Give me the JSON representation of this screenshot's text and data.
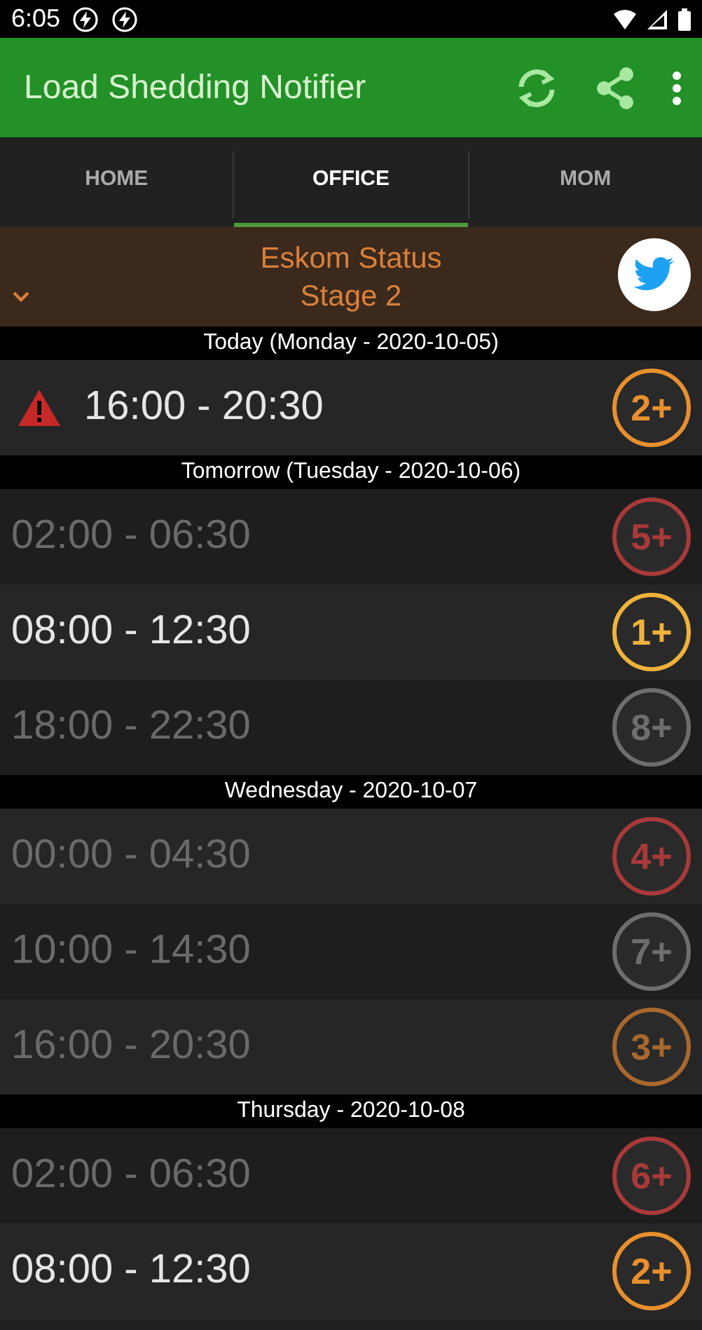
{
  "status_bar": {
    "time": "6:05"
  },
  "app_bar": {
    "title": "Load Shedding Notifier"
  },
  "tabs": [
    {
      "label": "HOME",
      "selected": false
    },
    {
      "label": "OFFICE",
      "selected": true
    },
    {
      "label": "MOM",
      "selected": false
    }
  ],
  "status_banner": {
    "title": "Eskom Status",
    "stage": "Stage 2",
    "expanded": false
  },
  "days": [
    {
      "header": "Today (Monday - 2020-10-05)",
      "slots": [
        {
          "time": "16:00 - 20:30",
          "stage": "2+",
          "color": "#e8902e",
          "faded": false,
          "alert": true
        }
      ]
    },
    {
      "header": "Tomorrow (Tuesday - 2020-10-06)",
      "slots": [
        {
          "time": "02:00 - 06:30",
          "stage": "5+",
          "color": "#a83a3a",
          "faded": true,
          "alert": false
        },
        {
          "time": "08:00 - 12:30",
          "stage": "1+",
          "color": "#f0b23a",
          "faded": false,
          "alert": false
        },
        {
          "time": "18:00 - 22:30",
          "stage": "8+",
          "color": "#6e6e6e",
          "faded": true,
          "alert": false
        }
      ]
    },
    {
      "header": "Wednesday - 2020-10-07",
      "slots": [
        {
          "time": "00:00 - 04:30",
          "stage": "4+",
          "color": "#a83a3a",
          "faded": true,
          "alert": false
        },
        {
          "time": "10:00 - 14:30",
          "stage": "7+",
          "color": "#6e6e6e",
          "faded": true,
          "alert": false
        },
        {
          "time": "16:00 - 20:30",
          "stage": "3+",
          "color": "#a8682e",
          "faded": true,
          "alert": false
        }
      ]
    },
    {
      "header": "Thursday - 2020-10-08",
      "slots": [
        {
          "time": "02:00 - 06:30",
          "stage": "6+",
          "color": "#a83a3a",
          "faded": true,
          "alert": false
        },
        {
          "time": "08:00 - 12:30",
          "stage": "2+",
          "color": "#e8902e",
          "faded": false,
          "alert": false
        }
      ]
    }
  ]
}
